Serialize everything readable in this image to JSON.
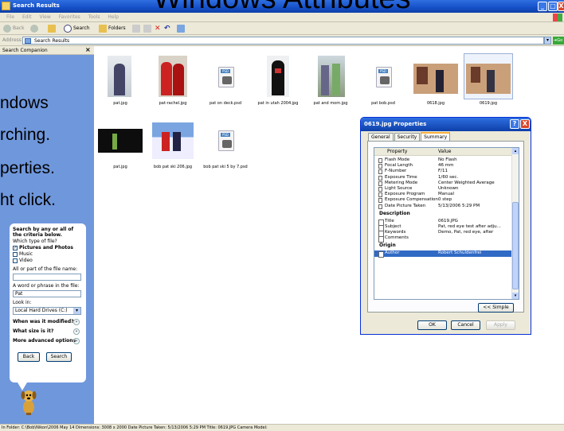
{
  "slide": {
    "title": "Windows Attributes",
    "lines": [
      "ndows",
      "rching.",
      "perties.",
      "ht click."
    ]
  },
  "window": {
    "title": "Search Results",
    "controls": {
      "minimize": "_",
      "maximize": "□",
      "close": "X"
    }
  },
  "menu": [
    "File",
    "Edit",
    "View",
    "Favorites",
    "Tools",
    "Help"
  ],
  "toolbar": {
    "back": "Back",
    "search": "Search",
    "folders": "Folders"
  },
  "address": {
    "label": "Address",
    "value": "Search Results",
    "go": "Go"
  },
  "companion": {
    "title": "Search Companion",
    "close": "×",
    "heading": "Search by any or all of the criteria below.",
    "filetype_label": "Which type of file?",
    "filetypes": [
      {
        "label": "Pictures and Photos",
        "checked": "✓"
      },
      {
        "label": "Music",
        "checked": ""
      },
      {
        "label": "Video",
        "checked": ""
      }
    ],
    "filename_label": "All or part of the file name:",
    "filename_value": "",
    "phrase_label": "A word or phrase in the file:",
    "phrase_value": "Pat",
    "lookin_label": "Look in:",
    "lookin_value": "Local Hard Drives (C:)",
    "expanders": [
      "When was it modified?",
      "What size is it?",
      "More advanced options"
    ],
    "back_button": "Back",
    "search_button": "Search"
  },
  "files": [
    {
      "name": "pat.jpg",
      "kind": "photo"
    },
    {
      "name": "pat-rachel.jpg",
      "kind": "photo"
    },
    {
      "name": "pat on deck.psd",
      "kind": "psd"
    },
    {
      "name": "pat in utah 2004.jpg",
      "kind": "photo"
    },
    {
      "name": "pat and mom.jpg",
      "kind": "photo"
    },
    {
      "name": "pat bob.psd",
      "kind": "psd"
    },
    {
      "name": "0618.jpg",
      "kind": "photo"
    },
    {
      "name": "0619.jpg",
      "kind": "photo"
    },
    {
      "name": "pat.jpg",
      "kind": "photo"
    },
    {
      "name": "bob pat ski 206.jpg",
      "kind": "photo"
    },
    {
      "name": "bob pat ski 5 by 7.psd",
      "kind": "psd"
    }
  ],
  "dialog": {
    "title": "0619.jpg Properties",
    "help": "?",
    "close": "X",
    "tabs": [
      "General",
      "Security",
      "Summary"
    ],
    "columns": {
      "property": "Property",
      "value": "Value"
    },
    "rows_top": [
      {
        "k": "Flash Mode",
        "v": "No Flash"
      },
      {
        "k": "Focal Length",
        "v": "46 mm"
      },
      {
        "k": "F-Number",
        "v": "F/11"
      },
      {
        "k": "Exposure Time",
        "v": "1/60 sec."
      },
      {
        "k": "Metering Mode",
        "v": "Center Weighted Average"
      },
      {
        "k": "Light Source",
        "v": "Unknown"
      },
      {
        "k": "Exposure Program",
        "v": "Manual"
      },
      {
        "k": "Exposure Compensation",
        "v": "0 step"
      },
      {
        "k": "Date Picture Taken",
        "v": "5/13/2006 5:29 PM"
      }
    ],
    "section_description": "Description",
    "rows_desc": [
      {
        "k": "Title",
        "v": "0619.JPG"
      },
      {
        "k": "Subject",
        "v": "Pat, red eye test after adju..."
      },
      {
        "k": "Keywords",
        "v": "Demo, Pat, red eye, after"
      },
      {
        "k": "Comments",
        "v": ""
      }
    ],
    "section_origin": "Origin",
    "rows_origin": [
      {
        "k": "Author",
        "v": "Robert Schuldenfrei"
      }
    ],
    "simple_button": "<< Simple",
    "ok": "OK",
    "cancel": "Cancel",
    "apply": "Apply"
  },
  "status": "In Folder: C:\\Bob\\Nikon\\2006 May 14 Dimensions: 3008 x 2000 Date Picture Taken: 5/13/2006 5:29 PM Title: 0619.JPG Camera Model:"
}
